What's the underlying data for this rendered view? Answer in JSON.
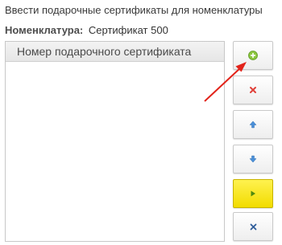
{
  "dialog": {
    "title": "Ввести подарочные сертификаты для номенклатуры"
  },
  "nomenclature": {
    "label": "Номенклатура:",
    "value": "Сертификат 500"
  },
  "table": {
    "column_header": "Номер подарочного сертификата",
    "rows": []
  },
  "buttons": [
    {
      "name": "add",
      "icon": "plus-circle-icon",
      "color": "#8cc63f"
    },
    {
      "name": "delete",
      "icon": "red-cross-icon",
      "color": "#e0413a"
    },
    {
      "name": "move-up",
      "icon": "arrow-up-icon",
      "color": "#4a90d9"
    },
    {
      "name": "move-down",
      "icon": "arrow-down-icon",
      "color": "#4a90d9"
    },
    {
      "name": "run",
      "icon": "play-icon",
      "color": "#4f8a10"
    },
    {
      "name": "close",
      "icon": "close-icon",
      "color": "#2f5d9a"
    }
  ],
  "annotation": {
    "icon": "red-arrow-pointer-icon",
    "color": "#e2231a"
  }
}
